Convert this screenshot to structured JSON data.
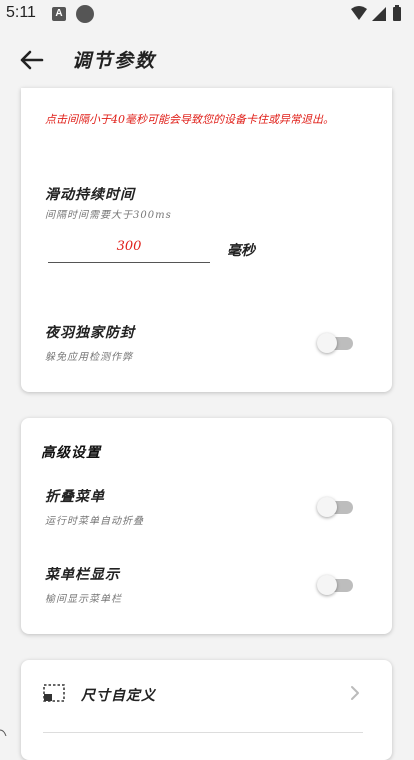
{
  "status": {
    "time": "5:11",
    "a_icon": "A"
  },
  "appbar": {
    "title": "调节参数"
  },
  "timing_card": {
    "warning": "点击间隔小于40毫秒可能会导致您的设备卡住或异常退出。",
    "duration_title": "滑动持续时间",
    "duration_sub": "间隔时间需要大于300ms",
    "duration_value": "300",
    "duration_unit": "毫秒",
    "anti_title": "夜羽独家防封",
    "anti_sub": "躲免应用检测作弊",
    "anti_on": false
  },
  "advanced_card": {
    "title": "高级设置",
    "fold_title": "折叠菜单",
    "fold_sub": "运行时菜单自动折叠",
    "fold_on": false,
    "menubar_title": "菜单栏显示",
    "menubar_sub": "榆间显示菜单栏",
    "menubar_on": false
  },
  "size_card": {
    "label": "尺寸自定义"
  },
  "colors": {
    "accent_red": "#e0201a",
    "switch_off": "#bdbdbd"
  }
}
